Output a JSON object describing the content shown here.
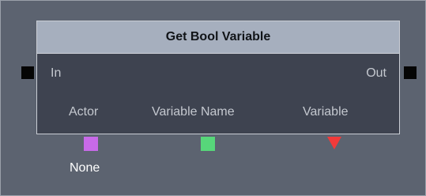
{
  "node": {
    "title": "Get Bool Variable",
    "input_port": "In",
    "output_port": "Out",
    "variable_links": [
      {
        "label": "Actor",
        "color": "#c86ae8",
        "shape": "square"
      },
      {
        "label": "Variable Name",
        "color": "#57d67a",
        "shape": "square"
      },
      {
        "label": "Variable",
        "color": "#f13a3a",
        "shape": "triangle-down"
      }
    ],
    "actor_value": "None"
  },
  "colors": {
    "background": "#5c6370",
    "node_header": "#a6afbe",
    "node_body": "#3e4350",
    "port": "#050505"
  }
}
